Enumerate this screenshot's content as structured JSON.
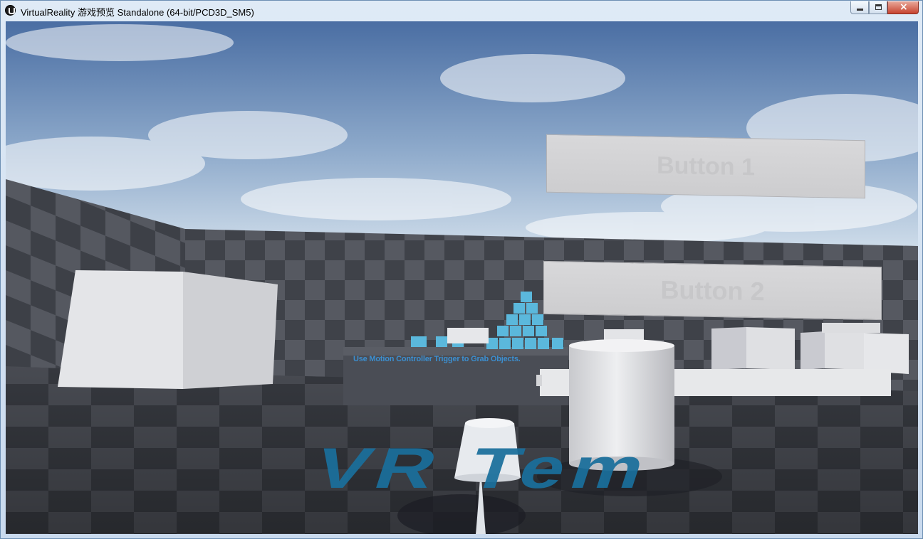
{
  "window": {
    "title": "VirtualReality 游戏预览 Standalone (64-bit/PCD3D_SM5)",
    "icon": "unreal-engine-logo",
    "controls": {
      "minimize": "minimize",
      "maximize": "maximize",
      "close": "×"
    }
  },
  "scene": {
    "buttons": [
      {
        "label": "Button 1"
      },
      {
        "label": "Button 2"
      }
    ],
    "instruction_text": "Use Motion Controller Trigger to Grab Objects.",
    "floor_text": "VR Tem",
    "colors": {
      "sky_top": "#4a6ea3",
      "sky_bottom": "#c8d9e8",
      "wall_dark": "#3f4249",
      "wall_light": "#5b5e66",
      "cube_accent": "#5bb8dc",
      "floor_text": "#1a6f9c",
      "ui_panel": "#d3d3d5"
    }
  }
}
